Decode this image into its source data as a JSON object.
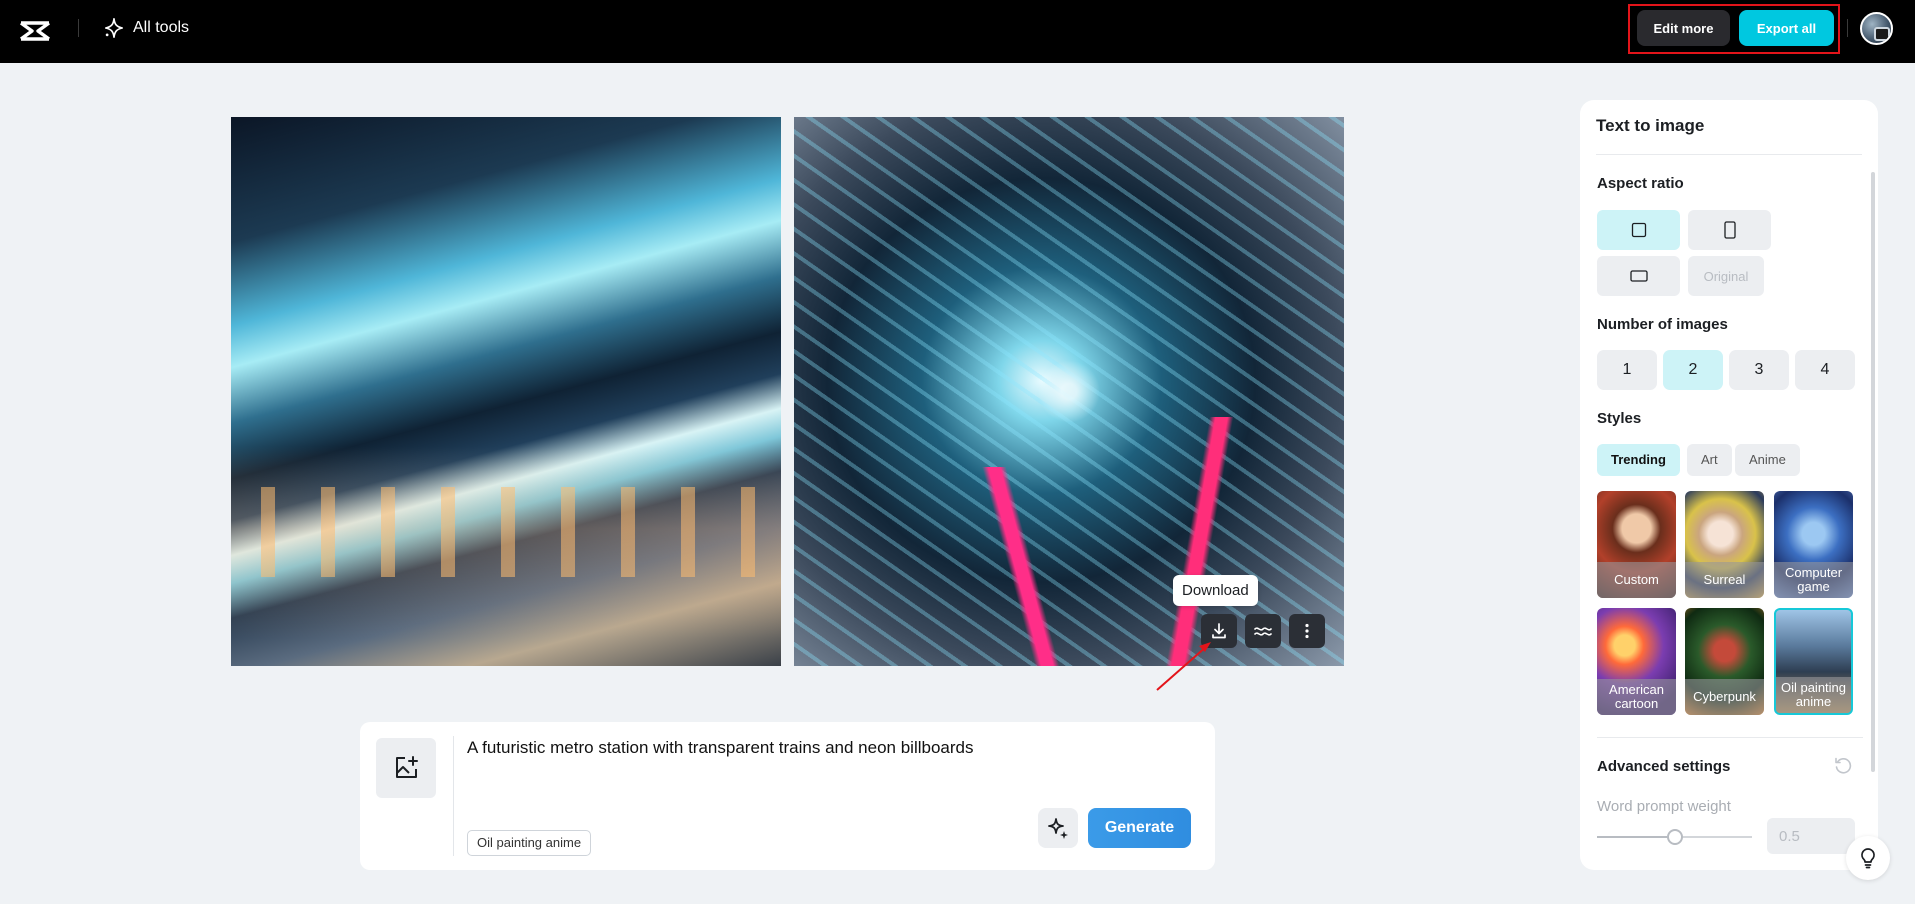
{
  "topbar": {
    "nav_label": "All tools",
    "edit_more": "Edit more",
    "export_all": "Export all"
  },
  "canvas": {
    "tooltip": "Download",
    "actions": [
      "download-icon",
      "wave-icon",
      "more-vertical-icon"
    ]
  },
  "prompt": {
    "text": "A futuristic metro station with transparent trains and neon billboards",
    "style_tag": "Oil painting anime",
    "generate": "Generate"
  },
  "panel": {
    "title": "Text to image",
    "aspect_ratio": {
      "label": "Aspect ratio",
      "original": "Original",
      "selected": "square"
    },
    "number_of_images": {
      "label": "Number of images",
      "options": [
        "1",
        "2",
        "3",
        "4"
      ],
      "selected": "2"
    },
    "styles": {
      "label": "Styles",
      "tabs": [
        "Trending",
        "Art",
        "Anime"
      ],
      "selected_tab": "Trending",
      "cards": [
        "Custom",
        "Surreal",
        "Computer game",
        "American cartoon",
        "Cyberpunk",
        "Oil painting anime"
      ],
      "selected_card": "Oil painting anime"
    },
    "advanced": {
      "label": "Advanced settings",
      "word_prompt_weight_label": "Word prompt weight",
      "word_prompt_weight_value": "0.5"
    }
  },
  "colors": {
    "accent": "#00c8e0",
    "generate": "#3b9be8",
    "highlight": "#e3141a"
  }
}
